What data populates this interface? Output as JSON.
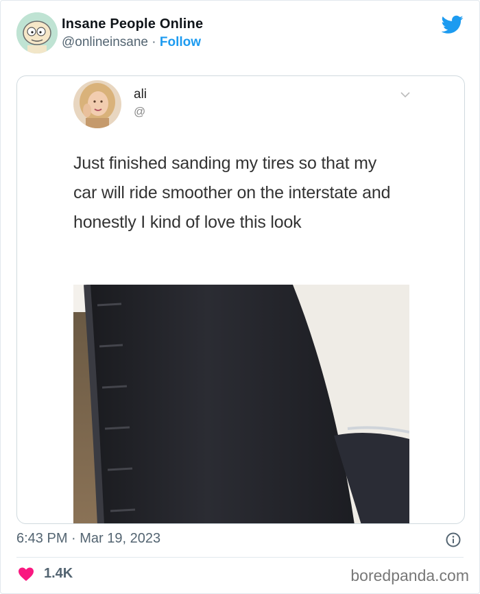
{
  "account": {
    "display_name": "Insane People Online",
    "handle": "@onlineinsane",
    "separator": "·",
    "follow_label": "Follow"
  },
  "embedded_tweet": {
    "name": "ali",
    "handle": "@",
    "text": "Just finished sanding my tires so that my car will ride smoother on the interstate and honestly I kind of love this look"
  },
  "meta": {
    "timestamp": "6:43 PM · Mar 19, 2023",
    "likes": "1.4K"
  },
  "watermark": "boredpanda.com",
  "colors": {
    "accent": "#1d9bf0",
    "like": "#f91880",
    "muted": "#536471"
  },
  "icons": [
    "twitter-bird-icon",
    "chevron-down-icon",
    "info-icon",
    "heart-icon"
  ]
}
